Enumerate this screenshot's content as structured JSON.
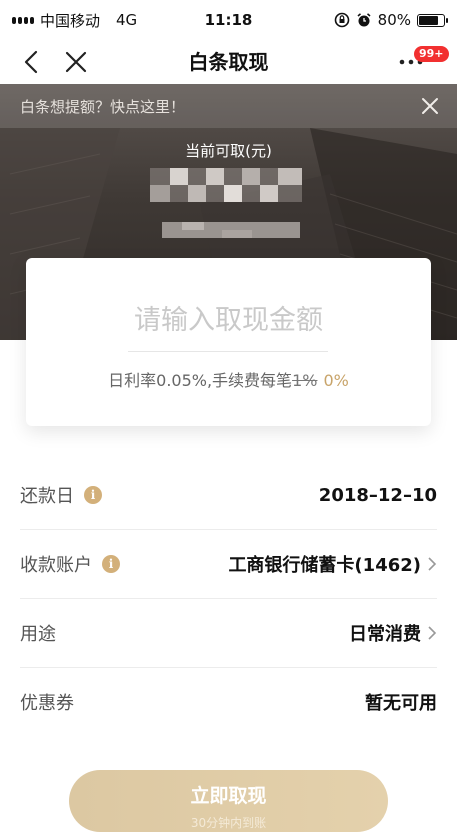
{
  "status_bar": {
    "carrier": "中国移动",
    "network": "4G",
    "time": "11:18",
    "battery_text": "80%",
    "battery_level": 0.8
  },
  "nav": {
    "title": "白条取现",
    "badge": "99+"
  },
  "hero": {
    "banner_text": "白条想提额？快点这里！",
    "available_label": "当前可取(元)"
  },
  "withdraw_card": {
    "amount_placeholder": "请输入取现金额",
    "rate_prefix": "日利率0.05%,手续费每笔",
    "rate_original": "1%",
    "rate_discounted": "0%"
  },
  "rows": [
    {
      "label": "还款日",
      "value": "2018–12–10"
    },
    {
      "label": "收款账户",
      "value": "工商银行储蓄卡(1462)"
    },
    {
      "label": "用途",
      "value": "日常消费"
    },
    {
      "label": "优惠券",
      "value": "暂无可用"
    }
  ],
  "submit": {
    "label": "立即取现",
    "sublabel": "30分钟内到账"
  },
  "colors": {
    "accent_gold": "#c8a46a",
    "badge_red": "#f23030",
    "button_bg": "#dcc8a2"
  }
}
